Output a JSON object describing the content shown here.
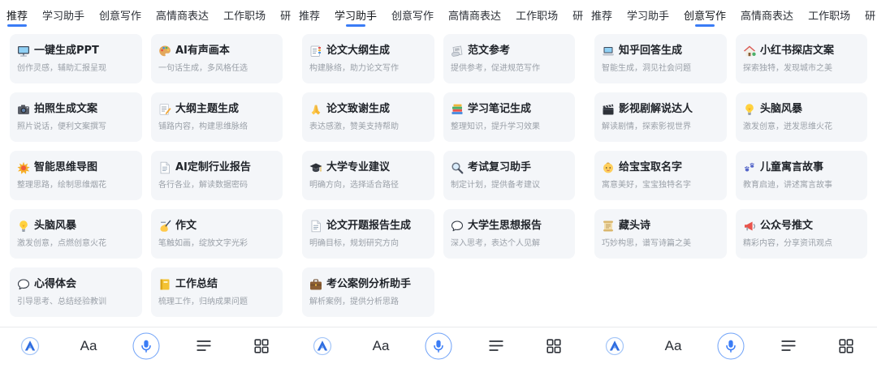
{
  "colors": {
    "accent": "#3a7cf6",
    "card_background": "#f4f6f9",
    "title_text": "#1f2329",
    "subtitle_text": "#9aa0a8",
    "tab_text": "#2b2f36",
    "divider": "#e9eaec"
  },
  "panels": [
    {
      "tabs": [
        "推荐",
        "学习助手",
        "创意写作",
        "高情商表达",
        "工作职场",
        "研"
      ],
      "active_tab": 0,
      "cards": [
        {
          "icon": "desktop-computer-icon",
          "title": "一键生成PPT",
          "subtitle": "创作灵感，辅助汇报呈现"
        },
        {
          "icon": "artist-palette-icon",
          "title": "AI有声画本",
          "subtitle": "一句话生成，多风格任选"
        },
        {
          "icon": "camera-icon",
          "title": "拍照生成文案",
          "subtitle": "照片说话，便利文案撰写"
        },
        {
          "icon": "memo-icon",
          "title": "大纲主题生成",
          "subtitle": "铺路内容，构建思维脉络"
        },
        {
          "icon": "collision-icon",
          "title": "智能思维导图",
          "subtitle": "整理思路，绘制思维烟花"
        },
        {
          "icon": "page-icon",
          "title": "AI定制行业报告",
          "subtitle": "各行各业，解读数据密码"
        },
        {
          "icon": "light-bulb-icon",
          "title": "头脑风暴",
          "subtitle": "激发创意，点燃创意火花"
        },
        {
          "icon": "writing-hand-icon",
          "title": "作文",
          "subtitle": "笔触如画，绽放文字光彩"
        },
        {
          "icon": "speech-bubble-icon",
          "title": "心得体会",
          "subtitle": "引导思考、总结经验教训"
        },
        {
          "icon": "ledger-icon",
          "title": "工作总结",
          "subtitle": "梳理工作，归纳成果问题"
        }
      ]
    },
    {
      "tabs": [
        "推荐",
        "学习助手",
        "创意写作",
        "高情商表达",
        "工作职场",
        "研"
      ],
      "active_tab": 1,
      "cards": [
        {
          "icon": "bookmark-tabs-icon",
          "title": "论文大纲生成",
          "subtitle": "构建脉络，助力论文写作"
        },
        {
          "icon": "rolled-newspaper-icon",
          "title": "范文参考",
          "subtitle": "提供参考，促进规范写作"
        },
        {
          "icon": "folded-hands-icon",
          "title": "论文致谢生成",
          "subtitle": "表达感激，赞美支持帮助"
        },
        {
          "icon": "books-icon",
          "title": "学习笔记生成",
          "subtitle": "整理知识，提升学习效果"
        },
        {
          "icon": "graduation-cap-icon",
          "title": "大学专业建议",
          "subtitle": "明确方向，选择适合路径"
        },
        {
          "icon": "magnifying-glass-icon",
          "title": "考试复习助手",
          "subtitle": "制定计划，提供备考建议"
        },
        {
          "icon": "page-icon",
          "title": "论文开题报告生成",
          "subtitle": "明确目标，规划研究方向"
        },
        {
          "icon": "speech-bubble-icon",
          "title": "大学生思想报告",
          "subtitle": "深入思考，表达个人见解"
        },
        {
          "icon": "briefcase-icon",
          "title": "考公案例分析助手",
          "subtitle": "解析案例，提供分析思路"
        }
      ]
    },
    {
      "tabs": [
        "推荐",
        "学习助手",
        "创意写作",
        "高情商表达",
        "工作职场",
        "研"
      ],
      "active_tab": 2,
      "cards": [
        {
          "icon": "laptop-icon",
          "title": "知乎回答生成",
          "subtitle": "智能生成，洞见社会问题"
        },
        {
          "icon": "house-icon",
          "title": "小红书探店文案",
          "subtitle": "探索独特，发现城市之美"
        },
        {
          "icon": "clapper-board-icon",
          "title": "影视剧解说达人",
          "subtitle": "解读剧情，探索影视世界"
        },
        {
          "icon": "light-bulb-icon",
          "title": "头脑风暴",
          "subtitle": "激发创意，迸发思维火花"
        },
        {
          "icon": "baby-icon",
          "title": "给宝宝取名字",
          "subtitle": "寓意美好，宝宝独特名字"
        },
        {
          "icon": "paw-prints-icon",
          "title": "儿童寓言故事",
          "subtitle": "教育启迪，讲述寓言故事"
        },
        {
          "icon": "scroll-icon",
          "title": "藏头诗",
          "subtitle": "巧妙构思，谱写诗篇之美"
        },
        {
          "icon": "loudspeaker-icon",
          "title": "公众号推文",
          "subtitle": "精彩内容，分享资讯观点"
        }
      ]
    }
  ],
  "toolbar": {
    "items": [
      {
        "icon": "app-logo-icon"
      },
      {
        "icon": "font-size-icon",
        "label": "Aa"
      },
      {
        "icon": "microphone-icon"
      },
      {
        "icon": "text-align-icon"
      },
      {
        "icon": "grid-apps-icon"
      }
    ]
  }
}
